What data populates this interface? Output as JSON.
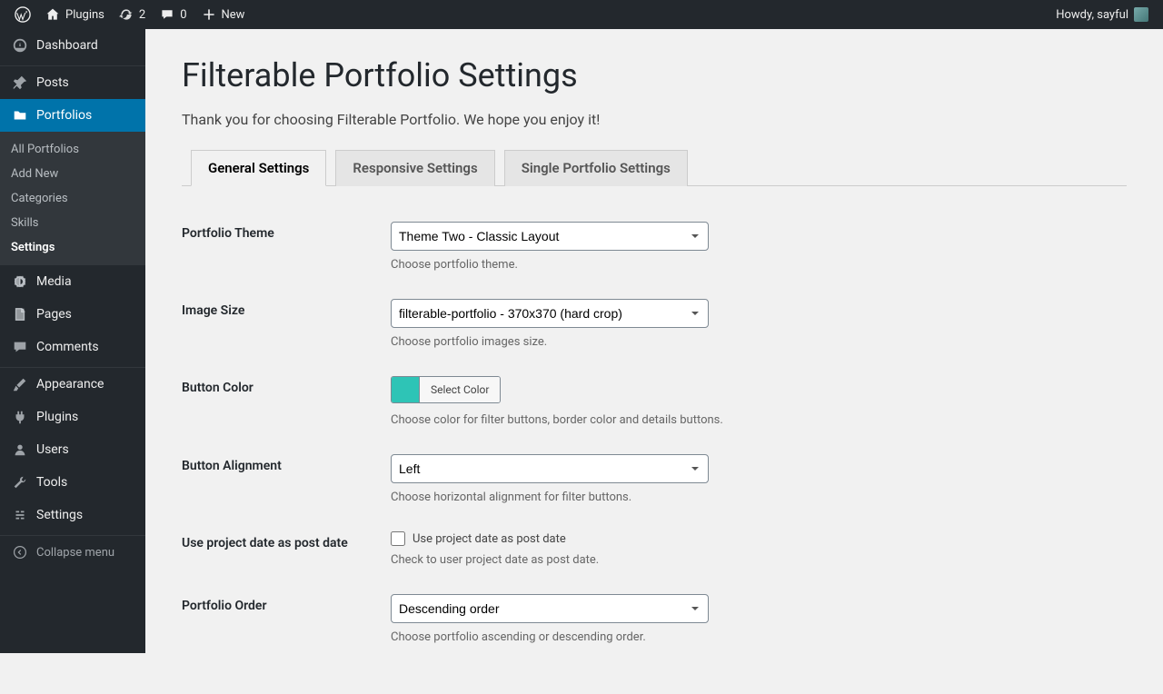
{
  "adminbar": {
    "site": "Plugins",
    "updates": "2",
    "comments": "0",
    "new": "New",
    "greeting": "Howdy, sayful"
  },
  "sidebar": {
    "dashboard": "Dashboard",
    "posts": "Posts",
    "portfolios": "Portfolios",
    "sub": {
      "all": "All Portfolios",
      "add": "Add New",
      "cats": "Categories",
      "skills": "Skills",
      "settings": "Settings"
    },
    "media": "Media",
    "pages": "Pages",
    "comments": "Comments",
    "appearance": "Appearance",
    "plugins": "Plugins",
    "users": "Users",
    "tools": "Tools",
    "settings": "Settings",
    "collapse": "Collapse menu"
  },
  "page": {
    "title": "Filterable Portfolio Settings",
    "subtitle": "Thank you for choosing Filterable Portfolio. We hope you enjoy it!"
  },
  "tabs": {
    "general": "General Settings",
    "responsive": "Responsive Settings",
    "single": "Single Portfolio Settings"
  },
  "fields": {
    "theme": {
      "label": "Portfolio Theme",
      "value": "Theme Two - Classic Layout",
      "desc": "Choose portfolio theme."
    },
    "image_size": {
      "label": "Image Size",
      "value": "filterable-portfolio - 370x370 (hard crop)",
      "desc": "Choose portfolio images size."
    },
    "button_color": {
      "label": "Button Color",
      "btn": "Select Color",
      "swatch": "#2ec4b6",
      "desc": "Choose color for filter buttons, border color and details buttons."
    },
    "button_align": {
      "label": "Button Alignment",
      "value": "Left",
      "desc": "Choose horizontal alignment for filter buttons."
    },
    "project_date": {
      "label": "Use project date as post date",
      "checkbox": "Use project date as post date",
      "desc": "Check to user project date as post date."
    },
    "order": {
      "label": "Portfolio Order",
      "value": "Descending order",
      "desc": "Choose portfolio ascending or descending order."
    }
  }
}
